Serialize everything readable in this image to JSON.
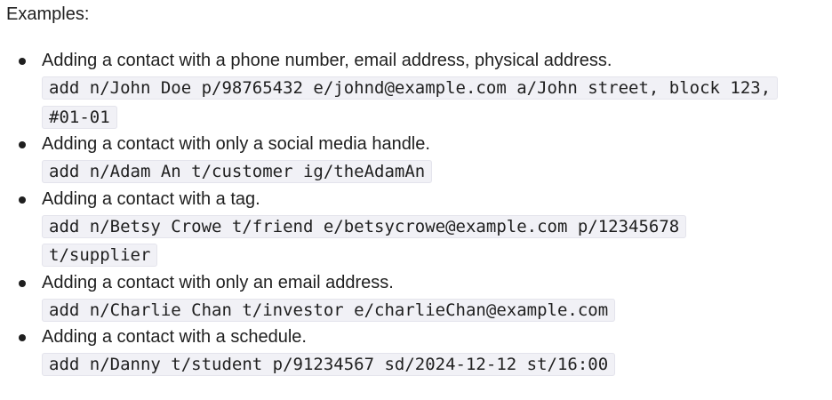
{
  "heading": "Examples:",
  "examples": [
    {
      "description": "Adding a contact with a phone number, email address, physical address.",
      "command_lines": [
        "add n/John Doe p/98765432 e/johnd@example.com a/John street, block 123,",
        "#01-01"
      ]
    },
    {
      "description": "Adding a contact with only a social media handle.",
      "command_lines": [
        "add n/Adam An t/customer ig/theAdamAn"
      ]
    },
    {
      "description": "Adding a contact with a tag.",
      "command_lines": [
        "add n/Betsy Crowe t/friend e/betsycrowe@example.com p/12345678",
        "t/supplier"
      ]
    },
    {
      "description": "Adding a contact with only an email address.",
      "command_lines": [
        "add n/Charlie Chan t/investor e/charlieChan@example.com"
      ]
    },
    {
      "description": "Adding a contact with a schedule.",
      "command_lines": [
        "add n/Danny t/student p/91234567 sd/2024-12-12 st/16:00"
      ]
    }
  ]
}
